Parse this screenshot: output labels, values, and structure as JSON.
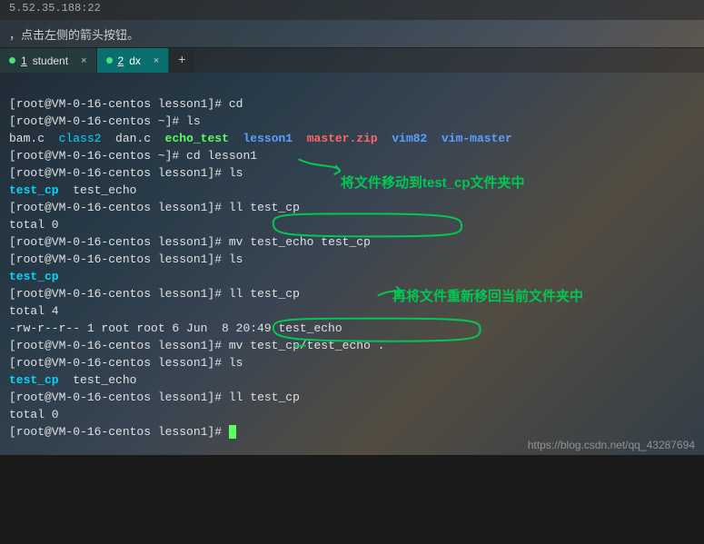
{
  "top_bar": {
    "ip": "5.52.35.188:22"
  },
  "hint_bar": {
    "text": "，点击左侧的箭头按钮。"
  },
  "tabs": [
    {
      "num": "1",
      "label": "student",
      "active": false
    },
    {
      "num": "2",
      "label": "dx",
      "active": true
    }
  ],
  "add_tab": "+",
  "term": {
    "ps_home": "[root@VM-0-16-centos ~]#",
    "ps_lesson": "[root@VM-0-16-centos lesson1]#",
    "cmd_cd": "cd",
    "cmd_ls": "ls",
    "ls_home": {
      "bam": "bam.c",
      "class2": "class2",
      "dan": "dan.c",
      "echo_test": "echo_test",
      "lesson1": "lesson1",
      "master": "master.zip",
      "vim82": "vim82",
      "vim_master": "vim-master"
    },
    "cmd_cd_lesson": "cd lesson1",
    "ls_lesson1": {
      "test_cp": "test_cp",
      "test_echo": "test_echo"
    },
    "cmd_ll_cp": "ll test_cp",
    "total0": "total 0",
    "cmd_mv1": "mv test_echo test_cp",
    "ls_lesson2": {
      "test_cp": "test_cp"
    },
    "total4": "total 4",
    "ll_line": "-rw-r--r-- 1 root root 6 Jun  8 20:49 test_echo",
    "cmd_mv2": "mv test_cp/test_echo .",
    "annot1": "将文件移动到test_cp文件夹中",
    "annot2": "再将文件重新移回当前文件夹中"
  },
  "watermark": "https://blog.csdn.net/qq_43287694"
}
